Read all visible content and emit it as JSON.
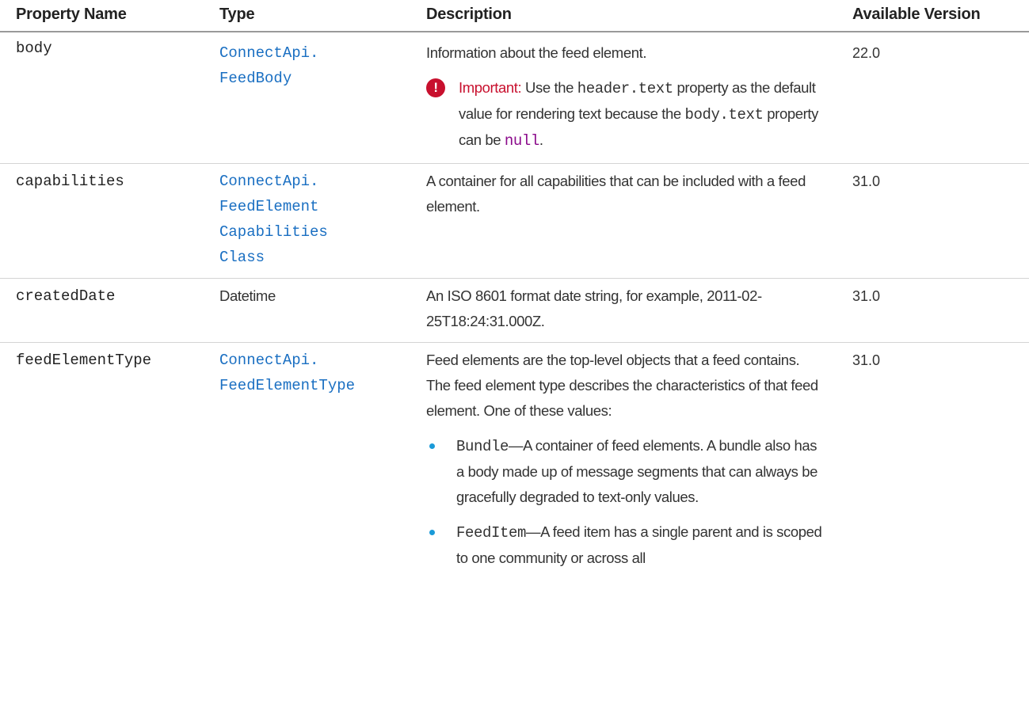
{
  "table": {
    "headers": [
      "Property Name",
      "Type",
      "Description",
      "Available Version"
    ],
    "rows": {
      "body": {
        "property": "body",
        "type_lines": [
          "ConnectApi.",
          "FeedBody"
        ],
        "description": "Information about the feed element.",
        "note": {
          "label": "Important:",
          "text_1": "Use the",
          "code_1": "header.text",
          "text_2": "property as the default value for rendering text because the",
          "code_2": "body.text",
          "text_3": "property can be",
          "code_3": "null",
          "text_4": "."
        },
        "version": "22.0"
      },
      "capabilities": {
        "property": "capabilities",
        "type_lines": [
          "ConnectApi.",
          "FeedElement",
          "Capabilities",
          "Class"
        ],
        "description": "A container for all capabilities that can be included with a feed element.",
        "version": "31.0"
      },
      "createdDate": {
        "property": "createdDate",
        "type": "Datetime",
        "description": "An ISO 8601 format date string, for example, 2011-02-25T18:24:31.000Z.",
        "version": "31.0"
      },
      "feedElementType": {
        "property": "feedElementType",
        "type_lines": [
          "ConnectApi.",
          "FeedElementType"
        ],
        "description": "Feed elements are the top-level objects that a feed contains. The feed element type describes the characteristics of that feed element. One of these values:",
        "values": [
          {
            "code": "Bundle",
            "text": "—A container of feed elements. A bundle also has a body made up of message segments that can always be gracefully degraded to text-only values."
          },
          {
            "code": "FeedItem",
            "text": "—A feed item has a single parent and is scoped to one community or across all"
          }
        ],
        "version": "31.0"
      }
    }
  },
  "colors": {
    "link": "#1a6fc2",
    "important": "#c8102e",
    "null_code": "#8b0a8b",
    "bullet": "#1a9ad8"
  },
  "icons": {
    "important": "exclamation-circle-icon"
  }
}
